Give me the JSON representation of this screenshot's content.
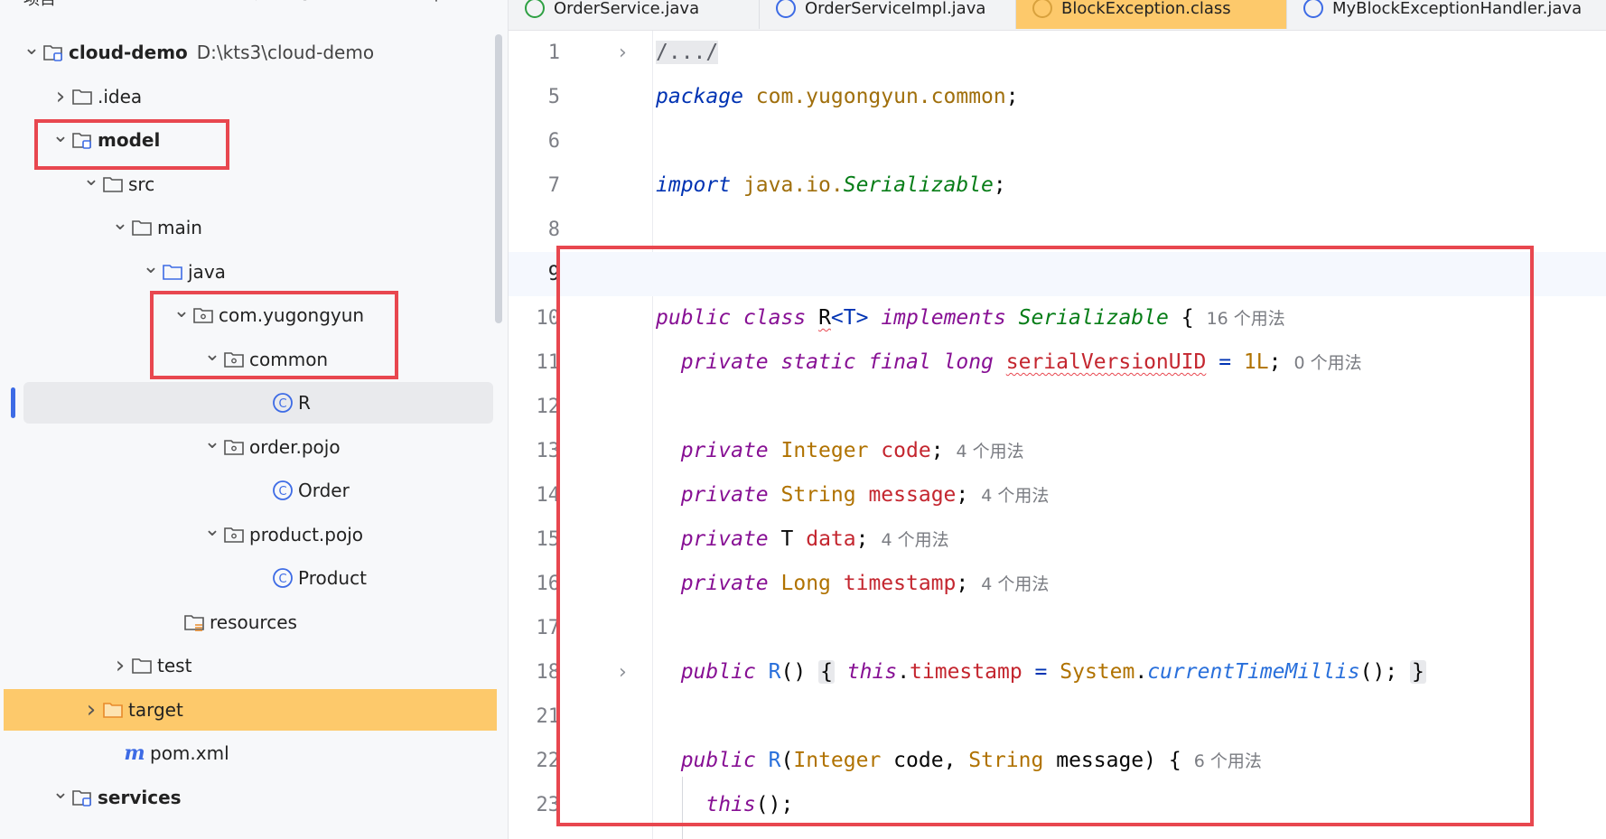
{
  "project_panel": {
    "title": "项目",
    "toolbar_icons": [
      "expand-icon",
      "crosshair-icon",
      "collapse-icon",
      "close-icon",
      "more-icon"
    ],
    "tree": [
      {
        "label": "cloud-demo",
        "path": "D:\\kts3\\cloud-demo",
        "icon": "module-icon",
        "expanded": true,
        "bold": true
      },
      {
        "label": ".idea",
        "icon": "folder-icon",
        "expanded": false
      },
      {
        "label": "model",
        "icon": "module-icon",
        "expanded": true,
        "bold": true
      },
      {
        "label": "src",
        "icon": "folder-icon",
        "expanded": true
      },
      {
        "label": "main",
        "icon": "folder-icon",
        "expanded": true
      },
      {
        "label": "java",
        "icon": "source-folder-icon",
        "expanded": true
      },
      {
        "label": "com.yugongyun",
        "icon": "package-icon",
        "expanded": true
      },
      {
        "label": "common",
        "icon": "package-icon",
        "expanded": true
      },
      {
        "label": "R",
        "icon": "class-icon",
        "selected": true
      },
      {
        "label": "order.pojo",
        "icon": "package-icon",
        "expanded": true
      },
      {
        "label": "Order",
        "icon": "class-icon"
      },
      {
        "label": "product.pojo",
        "icon": "package-icon",
        "expanded": true
      },
      {
        "label": "Product",
        "icon": "class-icon"
      },
      {
        "label": "resources",
        "icon": "resources-folder-icon"
      },
      {
        "label": "test",
        "icon": "folder-icon",
        "expanded": false
      },
      {
        "label": "target",
        "icon": "excluded-folder-icon",
        "expanded": false,
        "highlight": true
      },
      {
        "label": "pom.xml",
        "icon": "maven-icon"
      },
      {
        "label": "services",
        "icon": "module-icon",
        "expanded": true,
        "bold": true
      }
    ]
  },
  "tabs": [
    {
      "label": "OrderService.java",
      "icon": "interface-icon"
    },
    {
      "label": "OrderServiceImpl.java",
      "icon": "class-icon"
    },
    {
      "label": "BlockException.class",
      "icon": "class-file-icon",
      "active": true
    },
    {
      "label": "MyBlockExceptionHandler.java",
      "icon": "class-icon"
    }
  ],
  "editor": {
    "line_numbers": [
      "1",
      "5",
      "6",
      "7",
      "8",
      "9",
      "10",
      "11",
      "12",
      "13",
      "14",
      "15",
      "16",
      "17",
      "18",
      "21",
      "22",
      "23"
    ],
    "collapsed_header": "/.../",
    "package_kw": "package",
    "package_name": "com.yugongyun.common",
    "import_kw": "import",
    "import_pkg": "java.io.",
    "import_cls": "Serializable",
    "class_decl": {
      "public": "public",
      "class": "class",
      "name": "R",
      "generic": "<T>",
      "implements": "implements",
      "iface": "Serializable",
      "brace": "{",
      "hint": "16 个用法"
    },
    "serial": {
      "mods": "private static final",
      "type": "long",
      "name": "serialVersionUID",
      "eq": "=",
      "value": "1L",
      "semi": ";",
      "hint": "0 个用法"
    },
    "fields": [
      {
        "mod": "private",
        "type": "Integer",
        "name": "code",
        "hint": "4 个用法"
      },
      {
        "mod": "private",
        "type": "String",
        "name": "message",
        "hint": "4 个用法"
      },
      {
        "mod": "private",
        "type": "T",
        "name": "data",
        "hint": "4 个用法"
      },
      {
        "mod": "private",
        "type": "Long",
        "name": "timestamp",
        "hint": "4 个用法"
      }
    ],
    "ctor1": {
      "mod": "public",
      "name": "R",
      "parens": "()",
      "open": "{",
      "this": "this",
      "field": "timestamp",
      "eq": "=",
      "sys": "System",
      "method": "currentTimeMillis",
      "call": "();",
      "close": "}"
    },
    "ctor2": {
      "mod": "public",
      "name": "R",
      "p1type": "Integer",
      "p1name": "code",
      "p2type": "String",
      "p2name": "message",
      "hint": "6 个用法"
    },
    "this_call": {
      "kw": "this",
      "rest": "();"
    }
  },
  "colors": {
    "highlight_red": "#e8474f",
    "selection_yellow": "#fdc96b",
    "keyword": "#0033b3"
  }
}
